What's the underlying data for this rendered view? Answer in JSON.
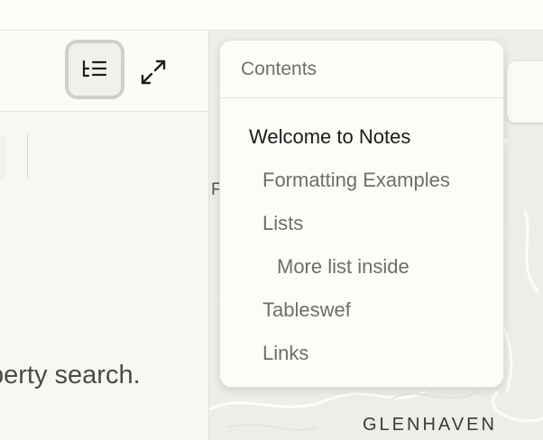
{
  "left_pane": {
    "body_text": "perty search."
  },
  "toc_popover": {
    "title": "Contents",
    "items": [
      {
        "label": "Welcome to Notes",
        "level": 1
      },
      {
        "label": "Formatting Examples",
        "level": 2
      },
      {
        "label": "Lists",
        "level": 2
      },
      {
        "label": "More list inside",
        "level": 3
      },
      {
        "label": "Tableswef",
        "level": 2
      },
      {
        "label": "Links",
        "level": 2
      }
    ]
  },
  "map": {
    "place_label": "GLENHAVEN",
    "partial_text": "F"
  },
  "icons": {
    "toc_button": "table-of-contents-icon",
    "expand_button": "expand-icon"
  }
}
